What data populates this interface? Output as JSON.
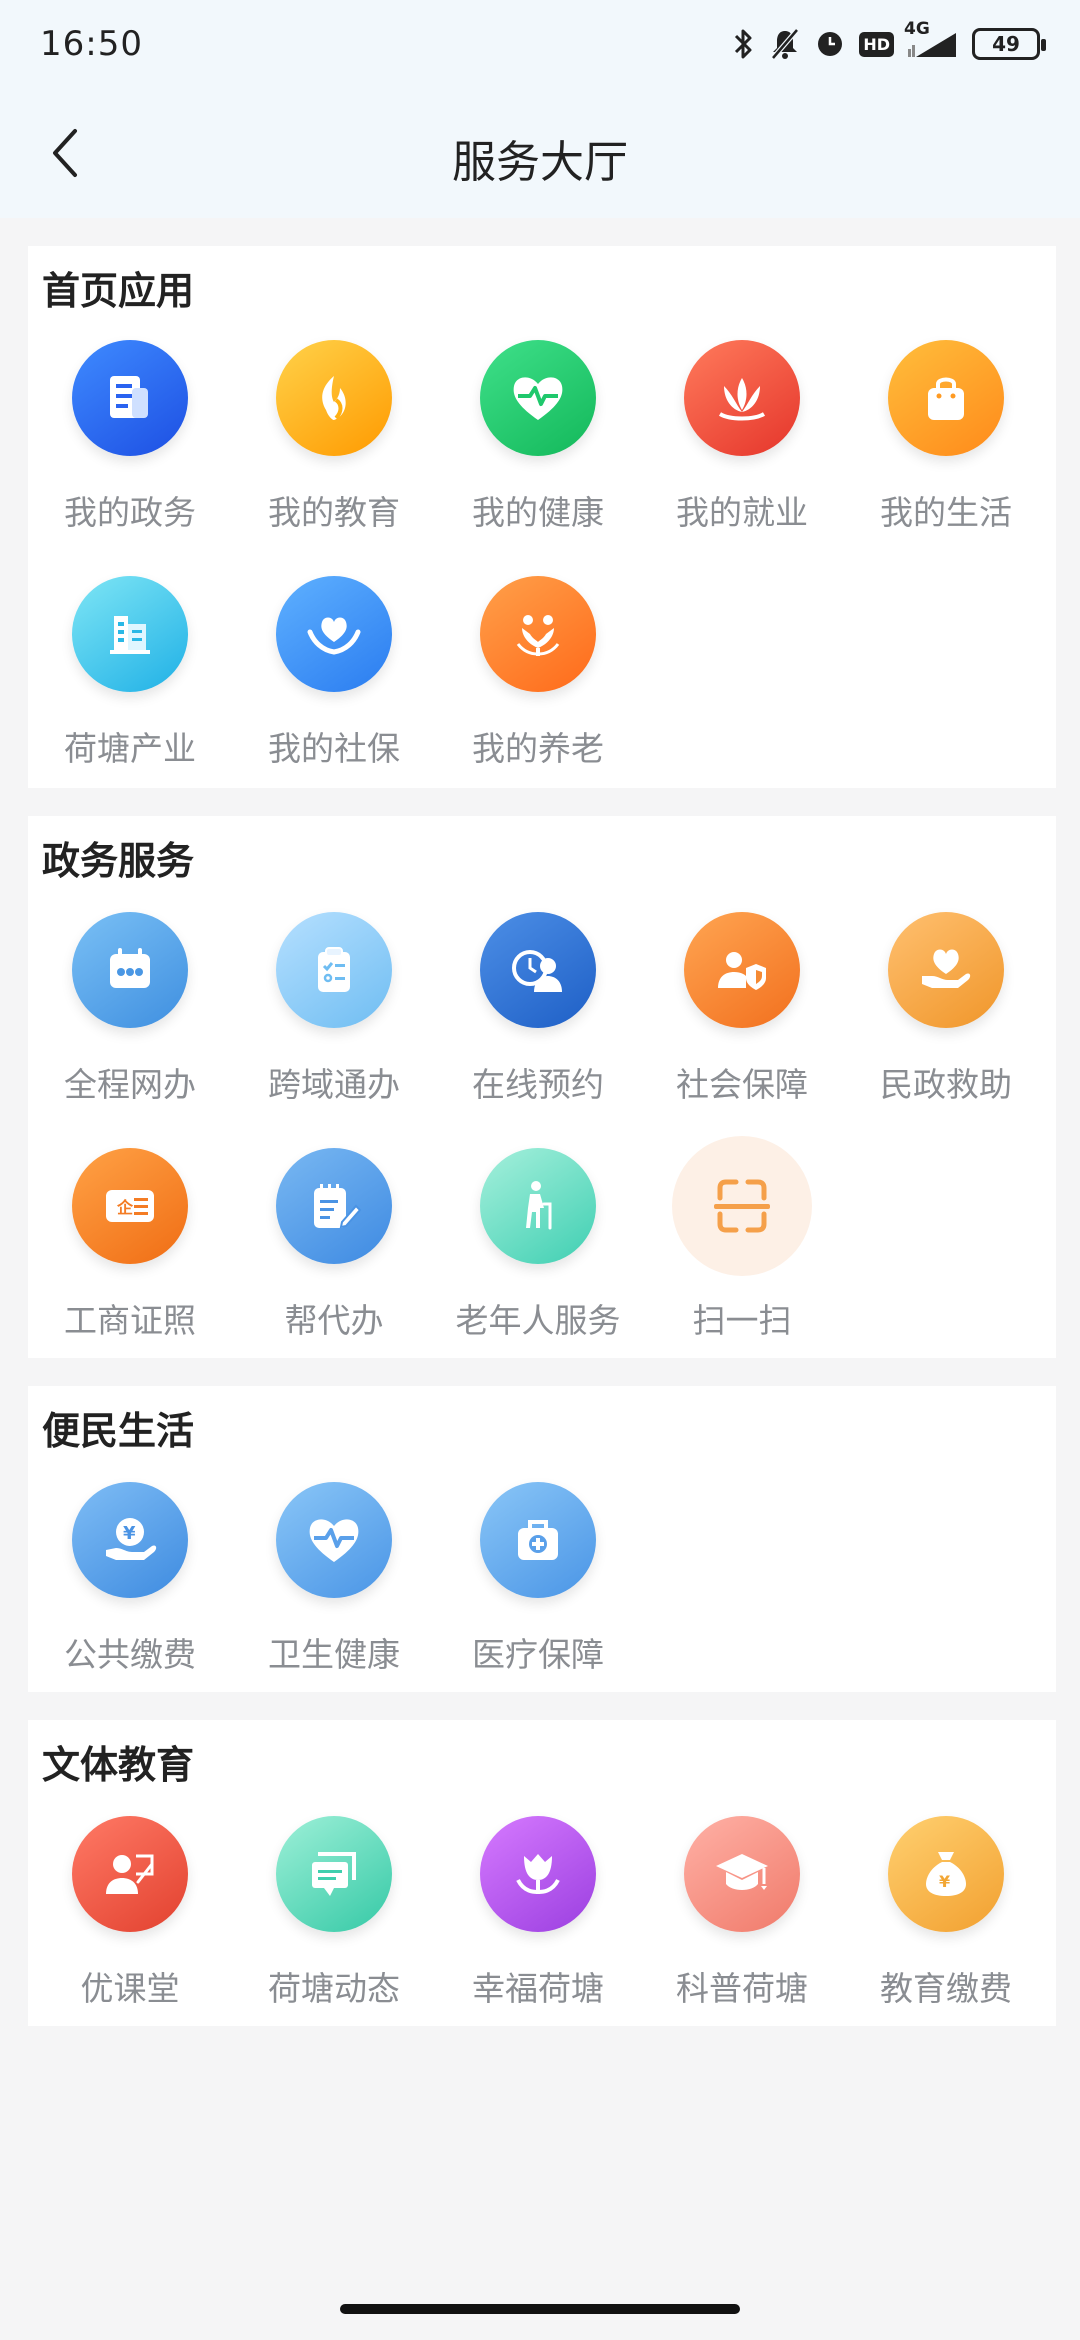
{
  "status_bar": {
    "time": "16:50",
    "network": "4G",
    "hd": "HD",
    "battery": "49"
  },
  "nav": {
    "title": "服务大厅"
  },
  "sections": [
    {
      "title": "首页应用",
      "items": [
        {
          "label": "我的政务",
          "icon": "document-icon"
        },
        {
          "label": "我的教育",
          "icon": "flame-icon"
        },
        {
          "label": "我的健康",
          "icon": "heartbeat-icon"
        },
        {
          "label": "我的就业",
          "icon": "lotus-icon"
        },
        {
          "label": "我的生活",
          "icon": "shopping-bag-icon"
        },
        {
          "label": "荷塘产业",
          "icon": "building-icon"
        },
        {
          "label": "我的社保",
          "icon": "heart-hands-icon"
        },
        {
          "label": "我的养老",
          "icon": "people-plant-icon"
        }
      ]
    },
    {
      "title": "政务服务",
      "items": [
        {
          "label": "全程网办",
          "icon": "calendar-icon"
        },
        {
          "label": "跨域通办",
          "icon": "clipboard-icon"
        },
        {
          "label": "在线预约",
          "icon": "clock-person-icon"
        },
        {
          "label": "社会保障",
          "icon": "person-shield-icon"
        },
        {
          "label": "民政救助",
          "icon": "heart-hand-icon"
        },
        {
          "label": "工商证照",
          "icon": "license-icon"
        },
        {
          "label": "帮代办",
          "icon": "notepad-pen-icon"
        },
        {
          "label": "老年人服务",
          "icon": "elder-cane-icon"
        },
        {
          "label": "扫一扫",
          "icon": "scan-icon"
        }
      ]
    },
    {
      "title": "便民生活",
      "items": [
        {
          "label": "公共缴费",
          "icon": "yuan-hand-icon"
        },
        {
          "label": "卫生健康",
          "icon": "heartbeat-icon"
        },
        {
          "label": "医疗保障",
          "icon": "medical-kit-icon"
        }
      ]
    },
    {
      "title": "文体教育",
      "items": [
        {
          "label": "优课堂",
          "icon": "teacher-icon"
        },
        {
          "label": "荷塘动态",
          "icon": "messages-icon"
        },
        {
          "label": "幸福荷塘",
          "icon": "tulip-icon"
        },
        {
          "label": "科普荷塘",
          "icon": "graduation-cap-icon"
        },
        {
          "label": "教育缴费",
          "icon": "money-bag-icon"
        }
      ]
    }
  ]
}
